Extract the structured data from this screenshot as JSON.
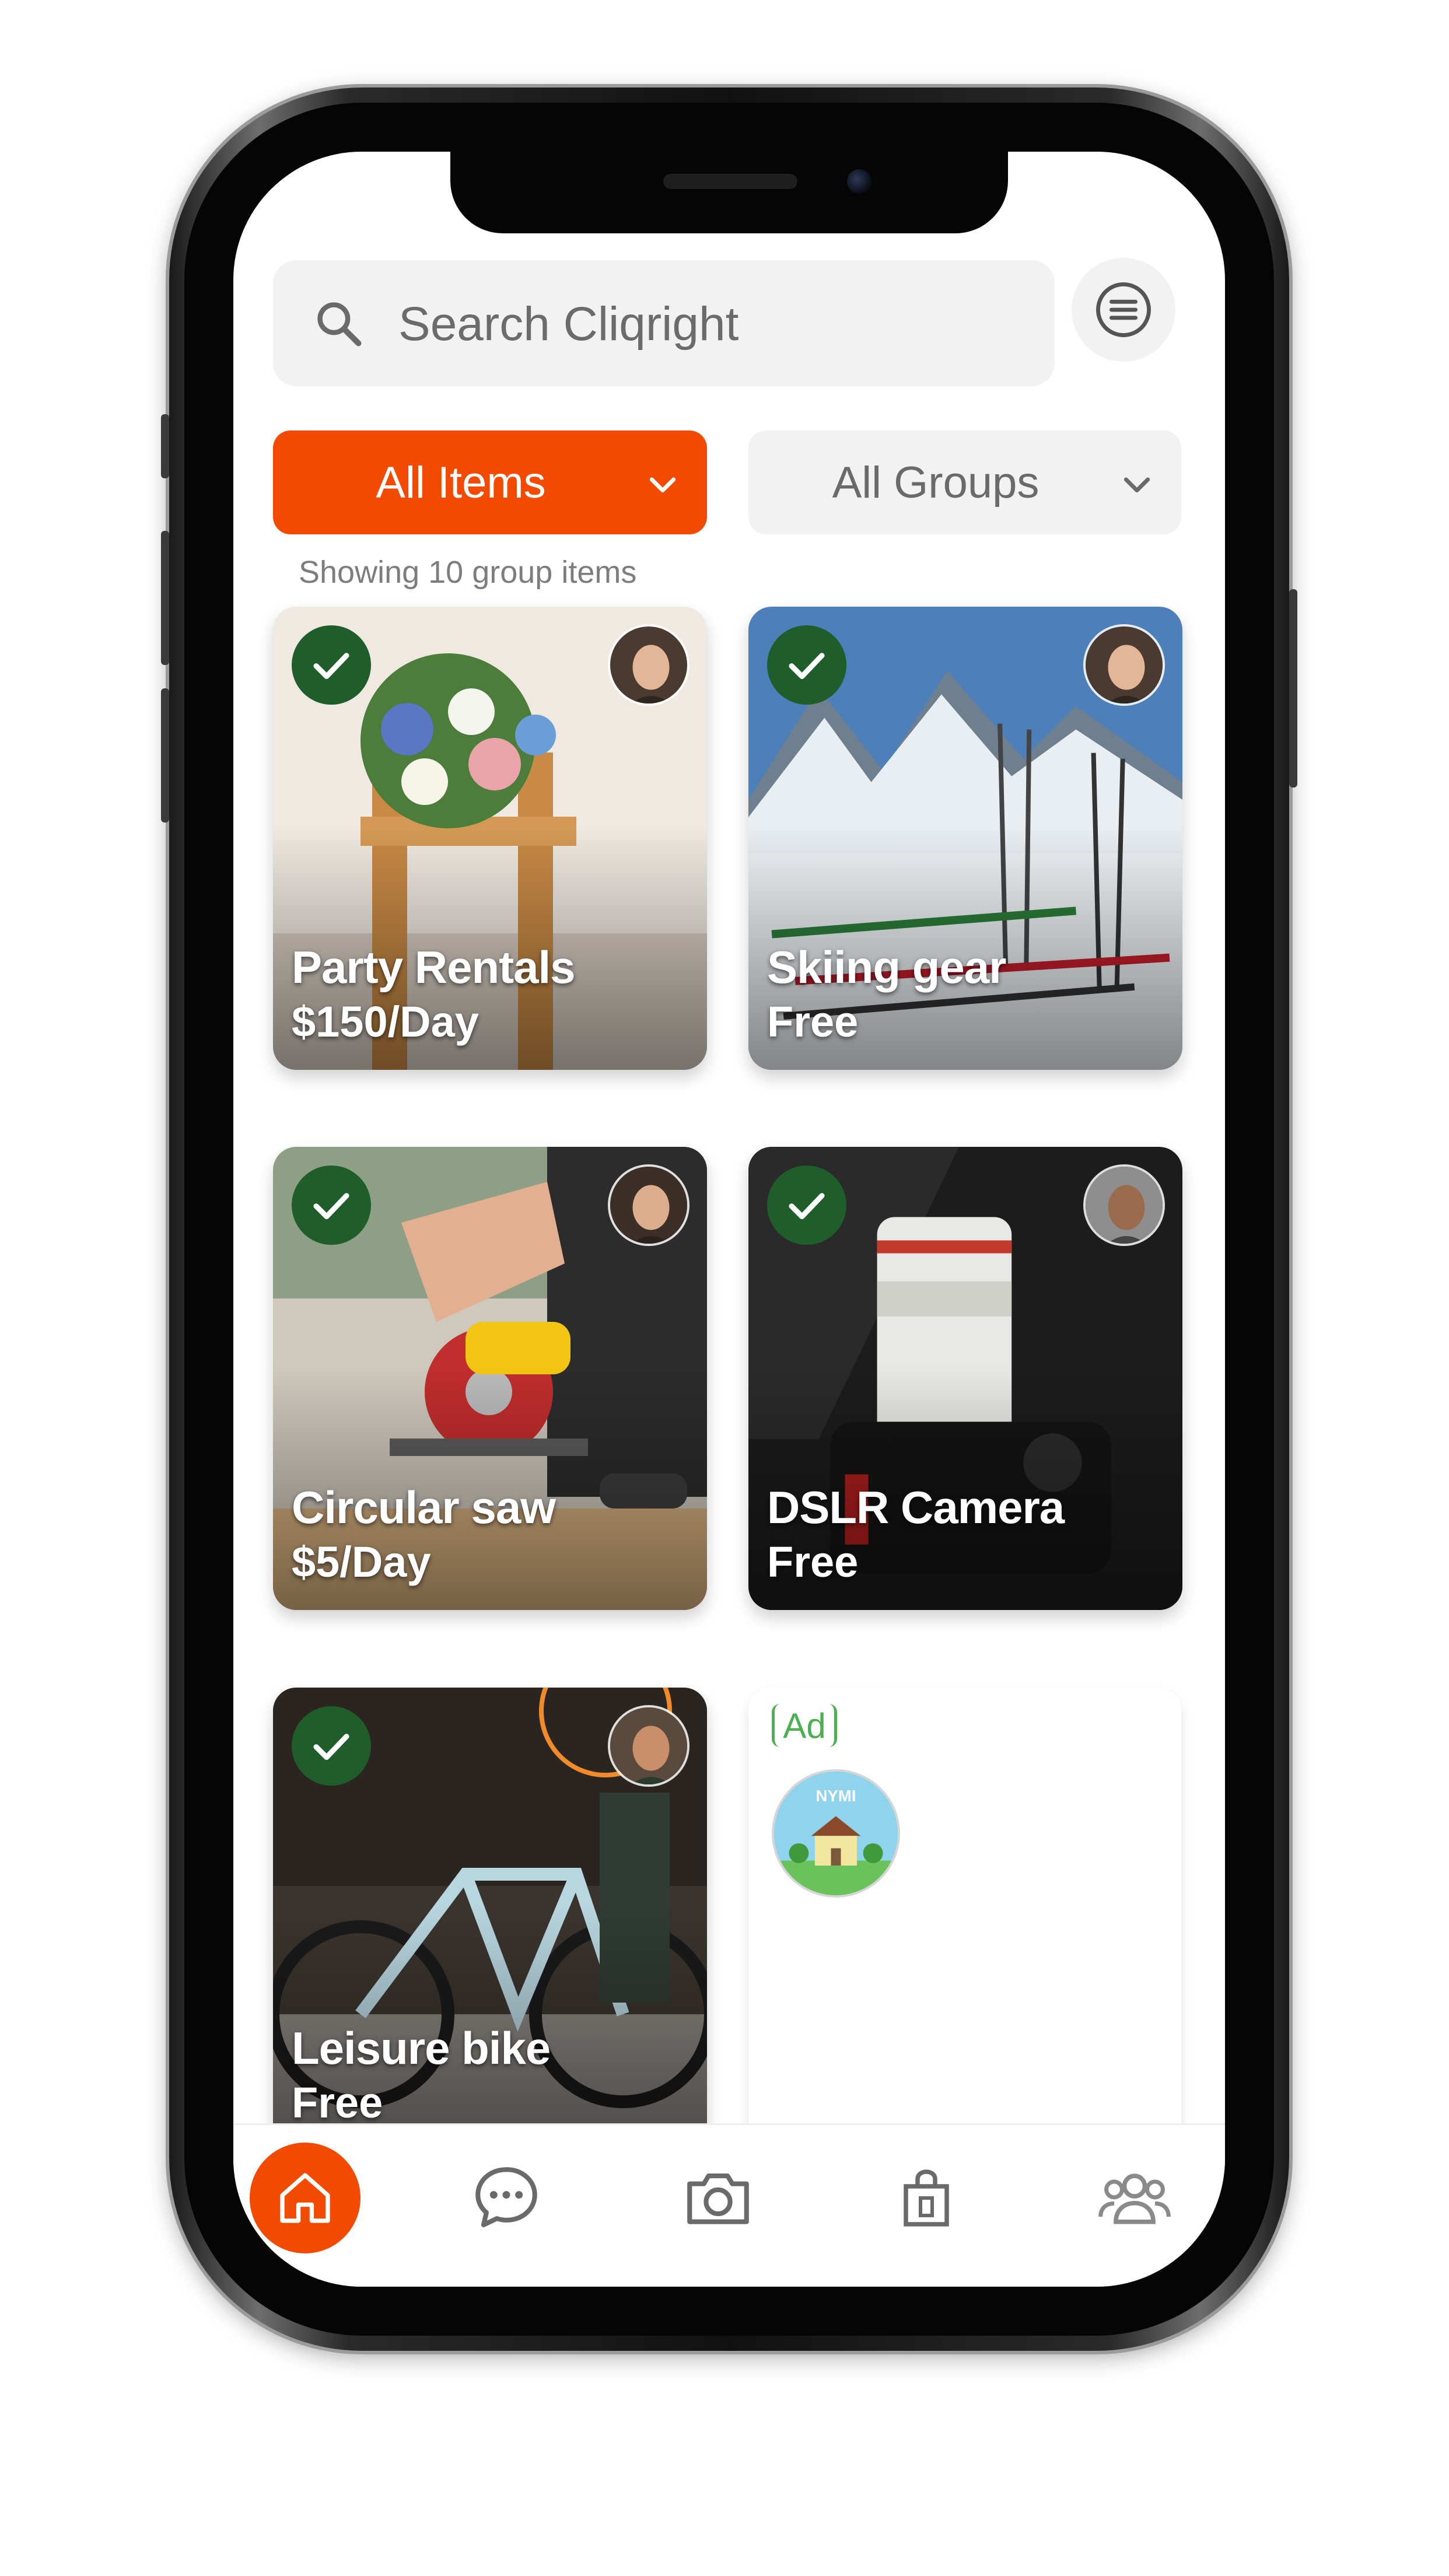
{
  "search": {
    "placeholder": "Search Cliqright"
  },
  "filters": {
    "items_label": "All Items",
    "groups_label": "All Groups"
  },
  "results_text": "Showing 10 group items",
  "cards": [
    {
      "title": "Party Rentals",
      "price": "$150/Day",
      "checked": true
    },
    {
      "title": "Skiing gear",
      "price": "Free",
      "checked": true
    },
    {
      "title": "Circular saw",
      "price": "$5/Day",
      "checked": true
    },
    {
      "title": "DSLR Camera",
      "price": "Free",
      "checked": true
    },
    {
      "title": "Leisure bike",
      "price": "Free",
      "checked": true
    }
  ],
  "ad": {
    "badge": "Ad",
    "logo_text": "NYMI"
  },
  "nav": {
    "items": [
      "home-icon",
      "chat-icon",
      "camera-icon",
      "shopping-bag-icon",
      "group-icon"
    ],
    "active": "home-icon"
  },
  "colors": {
    "accent": "#f24a00",
    "check": "#1f5e2a",
    "ad_green": "#4caf50"
  }
}
